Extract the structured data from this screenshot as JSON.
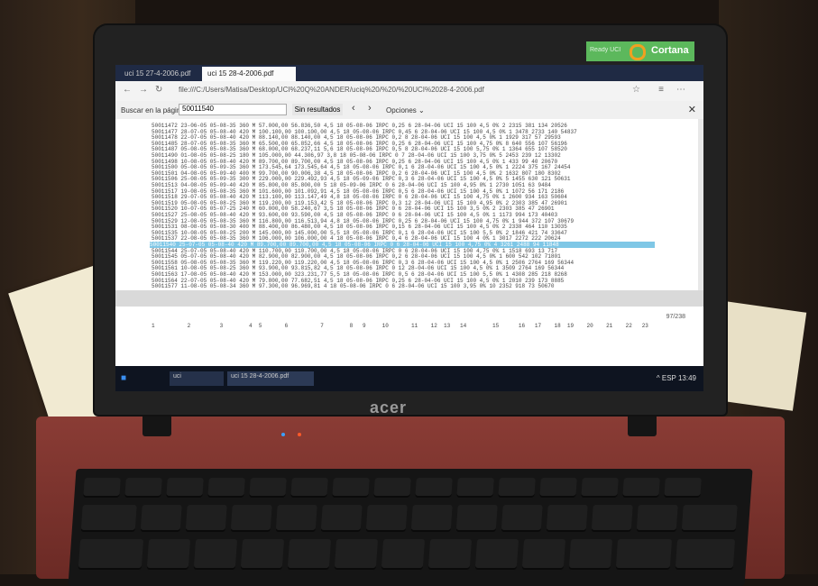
{
  "browser": {
    "tabs": [
      "uci 15 27-4-2006.pdf",
      "uci 15 28-4-2006.pdf"
    ],
    "url": "file:///C:/Users/Matisa/Desktop/UCI%20Q%20ANDER/uciq%20/%20/%20UCI%2028-4-2006.pdf"
  },
  "find": {
    "label": "Buscar en la página",
    "value": "50011540",
    "result": "Sin resultados",
    "options_label": "Opciones ⌄"
  },
  "cortana": {
    "label": "Cortana",
    "sub": "Ready UCI"
  },
  "logo": "acer",
  "doc": {
    "rows": [
      "50011472  23-06-05  05-08-35  360  M  57.000,00   56.836,50   4,5  18  05-08-06  IRPC  0,25  6   28-04-06  UCI 15  100  4,5  0%  2  2315  381  134  20526",
      "50011477  28-07-05  05-08-40  420  M  100.100,00  100.100,00  4,5  18  05-08-06  IRPC  0,45  6   28-04-06  UCI 15  100  4,5  0%  1  3478  2733  140  54837",
      "50011478  22-07-05  05-08-40  420  M  88.140,00   88.140,00   4,5  18  05-08-06  IRPC  0,2   8   28-04-06  UCI 15  100  4,5  0%  1  1929  317  57   29593",
      "50011485  28-07-05  05-08-35  360  M  65.500,00   65.852,66   4,5  18  05-08-06  IRPC  0,25  6   28-04-06  UCI 15  100  4,75  0%  8  640  556  107  56196",
      "50011487  05-08-05  05-08-35  360  M  68.000,00   68.237,11   5,6  18  05-08-06  IRPC  0,5   8   28-04-06  UCI 15  100  5,75  0%  1  1364  655  107  58520",
      "50011490  01-08-05  05-08-25  180  M  105.000,00  44.306,97   3,8  18  05-08-06  IRPC  0     7   28-04-06  UCI 15  100  3,75  0%  5  2453  239  12   13302",
      "50011498  10-08-05  05-08-40  420  M  89.700,00   89.700,00   4,5  18  05-08-06  IRPC  0,25  6   28-04-06  UCI 15  100  4,5  0%  1  433  99  40   20670",
      "50011500  05-08-05  05-09-35  360  M  173.545,64  173.545,64  4,5  18  05-08-06  IRPC  0,1   6   28-04-06  UCI 15  100  4,5  0%  1  2224  375  167  24454",
      "50011501  04-08-05  05-09-40  400  M  99.700,00   90.006,38   4,5  18  05-08-06  IRPC  0,2   6   28-04-06  UCI 15  100  4,5  0%  2  1632  807  180  8302",
      "50011506  25-08-05  05-09-35  300  M  229.000,00  229.492,93  4,5  18  05-09-06  IRPC  0,3   6   28-04-06  UCI 15  100  4,5  0%  5  1455  630  121  50631",
      "50011513  04-08-05  05-09-40  420  M  85.800,00   85.800,00   5    18  05-09-06  IRPC  0     6   28-04-06  UCI 15  100  4,95  0%  1  2730  1051  63   9484",
      "50011517  19-08-05  05-08-35  360  M  101.600,00  101.092,91  4,5  18  05-08-06  IRPC  0,5   6   28-04-06  UCI 15  100  4,5  0%  1  1072  56  171  2186",
      "50011518  29-07-05  05-08-40  420  M  113.100,00  113.147,49  4,8  18  05-08-06  IRPC  0     6   28-04-06  UCI 15  100  4,75  0%  1  2600  934  163  50604",
      "50011519  05-08-05  05-08-25  360  M  119.200,00  119.153,42  5    18  05-08-06  IRPC  0,3   12  28-04-06  UCI 15  100  4,95  0%  2  2303  385  47   26901",
      "50011520  10-07-05  05-07-25  240  M  60.000,00   58.240,67   3,5  18  05-08-06  IRPC  0     6   28-04-06  UCI 15  100  3,5  0%  2  2303  385  47   26901",
      "50011527  25-08-05  05-08-40  420  M  93.600,00   93.590,00   4,5  18  05-08-06  IRPC  0     6   28-04-06  UCI 15  100  4,5  0%  1  1173  994  173  40403",
      "50011529  12-08-05  05-08-35  360  M  116.800,00  116.513,94  4,8  18  05-08-06  IRPC  0,25  6   28-04-06  UCI 15  100  4,75  0%  1  944  372  107  30679",
      "50011531  08-08-05  05-08-30  400  M  88.400,00   86.480,00   4,5  18  05-08-06  IRPC  0,15  6   28-04-06  UCI 15  100  4,5  0%  2  2338  464  110  13035",
      "50011535  10-08-05  05-08-25  200  M  145.000,00  145.000,00  5,5  18  05-08-06  IRPC  0,1   6   28-04-06  UCI 15  100  5,5  0%  2  1846  421  74   33647",
      "50011537  22-08-05  05-08-35  360  M  106.000,00  106.000,00  4    18  05-08-06  IRPC  0,4   6   28-04-06  UCI 15  100  4    0%  1  3017  2272  222  20624",
      "50011540  25-07-05  05-08-40  420  M  89.700,00   89.700,00   4,5  18  05-08-06  IRPC  0     6   28-04-06  UCI 15  100  4,75  0%  4  3261  2488  94   11848",
      "50011544  25-07-05  05-08-40  420  M  110.700,00  110.700,00  4,5  18  05-08-06  IRPC  0     6   28-04-06  UCI 15  100  4,75  0%  1  1518  693  13   717",
      "50011545  05-07-05  05-08-40  420  M  82.900,00   82.900,00   4,5  18  05-08-06  IRPC  0,2   6   28-04-06  UCI 15  100  4,5  0%  1  600  542  102  71801",
      "50011558  05-08-05  05-08-35  360  M  119.220,00  119.220,00  4,5  18  05-08-06  IRPC  0,3   6   28-04-06  UCI 15  100  4,5  0%  1  2506  2764  169  56344",
      "50011561  10-08-05  05-08-25  360  M  93.900,00   93.815,82  4,5  18  05-08-06  IRPC  0     12  28-04-06  UCI 15  100  4,5  0%  1  3509  2764  169  56344",
      "50011563  17-08-05  05-08-40  420  M  153.000,00  323.231,77  5,5  18  05-08-06  IRPC  0,5   6   28-04-06  UCI 15  100  5,5  0%  1  4308  285  218  8268",
      "50011564  22-07-05  05-08-40  420  M  79.800,00   77.682,51  4,5  18  05-08-06  IRPC  0,25  6   28-04-06  UCI 15  100  4,5  0%  1  2010  239  173  8885",
      "50011577  11-08-05  05-08-34  360  M  97.300,00   96.969,81  4    18  05-08-06  IRPC  0     6   28-04-06  UCI 15  100  3,95  0%  10  2352  918  73  50670"
    ],
    "page_number": "97/238",
    "header2": "1          2         3        4  5       6          7        8   9     10       11    12  13   14        15      16   17    18  19    20    21    22   23"
  },
  "taskbar": {
    "items": [
      "uci",
      "uci 15 28-4-2006.pdf"
    ],
    "tray": "^  ESP   13:49"
  }
}
